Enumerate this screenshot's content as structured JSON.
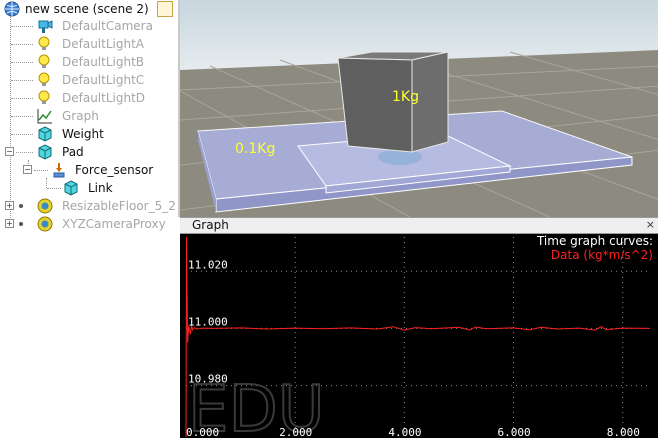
{
  "hierarchy": {
    "root_label": "new scene (scene 2)",
    "items": [
      {
        "label": "DefaultCamera",
        "icon": "camera-icon"
      },
      {
        "label": "DefaultLightA",
        "icon": "light-icon"
      },
      {
        "label": "DefaultLightB",
        "icon": "light-icon"
      },
      {
        "label": "DefaultLightC",
        "icon": "light-icon"
      },
      {
        "label": "DefaultLightD",
        "icon": "light-icon"
      },
      {
        "label": "Graph",
        "icon": "graph-icon"
      },
      {
        "label": "Weight",
        "icon": "cube-icon"
      },
      {
        "label": "Pad",
        "icon": "cube-icon"
      },
      {
        "label": "Force_sensor",
        "icon": "force-sensor-icon"
      },
      {
        "label": "Link",
        "icon": "cube-icon"
      },
      {
        "label": "ResizableFloor_5_2",
        "icon": "model-icon"
      },
      {
        "label": "XYZCameraProxy",
        "icon": "model-icon"
      }
    ]
  },
  "viewport": {
    "weight_label": "1Kg",
    "pad_label": "0.1Kg"
  },
  "graph": {
    "title": "Graph",
    "close_glyph": "×",
    "legend_title": "Time graph curves:",
    "watermark": "EDU",
    "colors": {
      "background": "#000000",
      "series": "#ff2020",
      "grid": "#8a8a8a"
    }
  },
  "chart_data": {
    "type": "line",
    "title": "Time graph curves:",
    "xlabel": "",
    "ylabel": "",
    "xlim": [
      0,
      8.5
    ],
    "ylim": [
      10.962,
      11.032
    ],
    "x_ticks": [
      "0.000",
      "2.000",
      "4.000",
      "6.000",
      "8.000"
    ],
    "y_ticks": [
      "11.020",
      "11.000",
      "10.980"
    ],
    "grid": true,
    "legend_position": "top-right",
    "series": [
      {
        "name": "Data (kg*m/s^2)",
        "x": [
          0,
          0.01,
          0.03,
          0.05,
          0.08,
          0.1,
          0.12,
          0.15,
          0.2,
          0.3,
          0.5,
          1.0,
          1.5,
          2.0,
          2.5,
          3.0,
          3.5,
          3.8,
          4.0,
          4.2,
          4.5,
          5.0,
          5.2,
          5.3,
          5.5,
          6.0,
          6.3,
          6.5,
          6.8,
          7.2,
          7.5,
          7.6,
          7.7,
          8.0,
          8.5
        ],
        "y": [
          10.962,
          11.032,
          10.995,
          11.001,
          10.998,
          11.001,
          10.9995,
          11.0003,
          10.9998,
          11.0001,
          11.0,
          11.0002,
          10.9998,
          11.0001,
          10.9999,
          11.0002,
          10.9998,
          11.0006,
          10.9994,
          11.0003,
          10.9999,
          11.0004,
          10.9994,
          11.0005,
          10.9999,
          11.0002,
          10.9995,
          11.0004,
          10.9998,
          11.0001,
          10.9994,
          11.0006,
          10.9996,
          11.0001,
          11.0
        ]
      }
    ]
  }
}
